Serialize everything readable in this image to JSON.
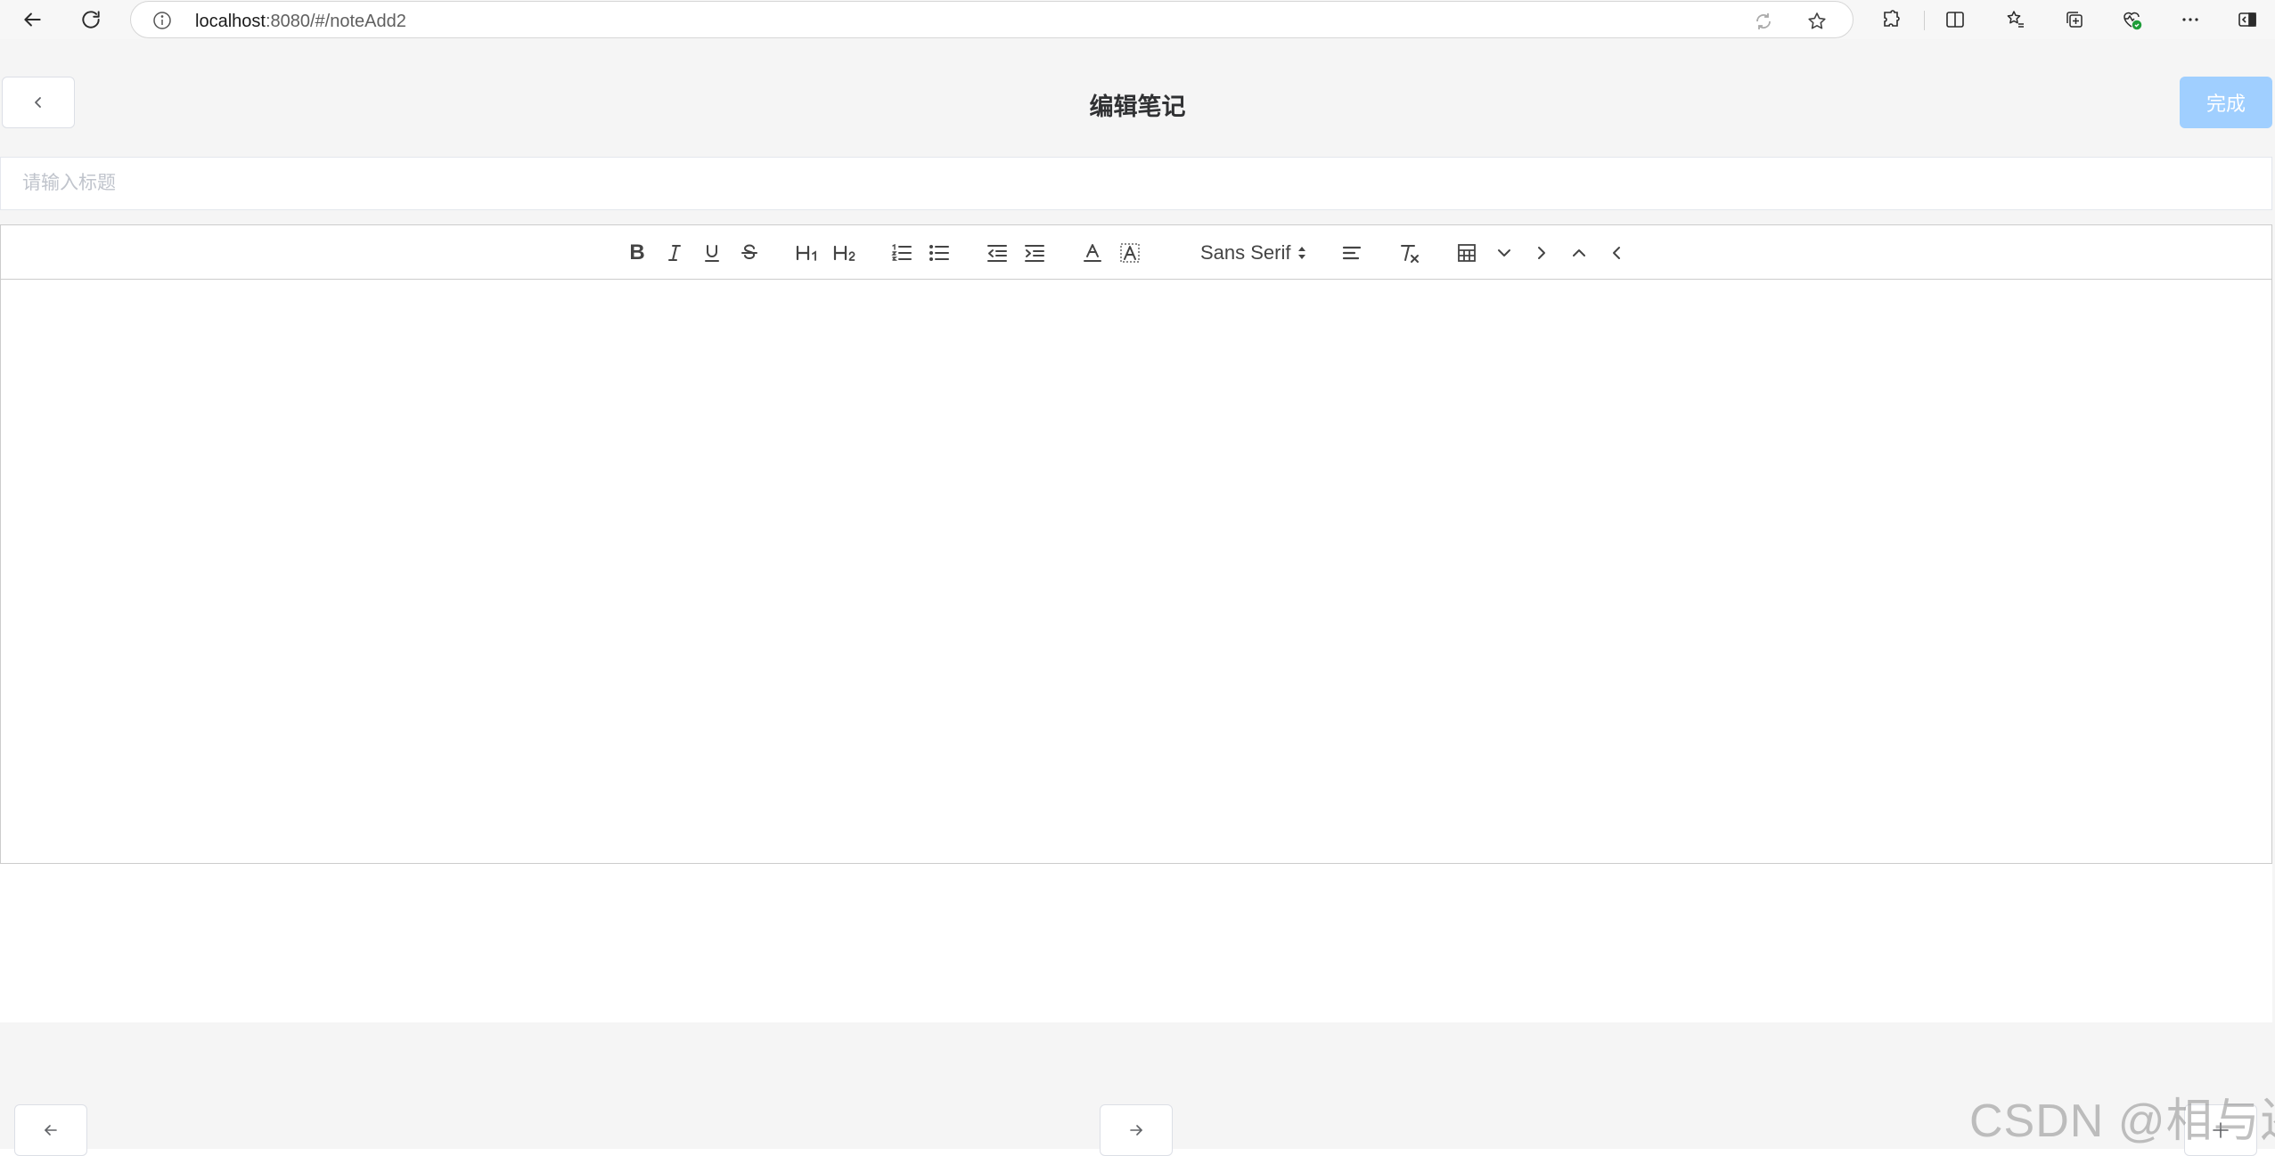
{
  "browser": {
    "url_host": "localhost",
    "url_rest": ":8080/#/noteAdd2"
  },
  "header": {
    "title": "编辑笔记",
    "done_label": "完成"
  },
  "title_field": {
    "placeholder": "请输入标题",
    "value": ""
  },
  "toolbar": {
    "font_label": "Sans Serif",
    "items": [
      {
        "name": "bold",
        "glyph": "B"
      },
      {
        "name": "italic",
        "glyph": "I"
      },
      {
        "name": "underline",
        "glyph": "U"
      },
      {
        "name": "strike",
        "glyph": "S"
      },
      {
        "name": "header-1",
        "glyph": "H1"
      },
      {
        "name": "header-2",
        "glyph": "H2"
      }
    ]
  },
  "watermark": "CSDN @相与还",
  "colors": {
    "primary_disabled": "#a0cfff",
    "page_bg": "#f5f5f5",
    "border": "#dcdfe6",
    "placeholder": "#c0c4cc"
  }
}
